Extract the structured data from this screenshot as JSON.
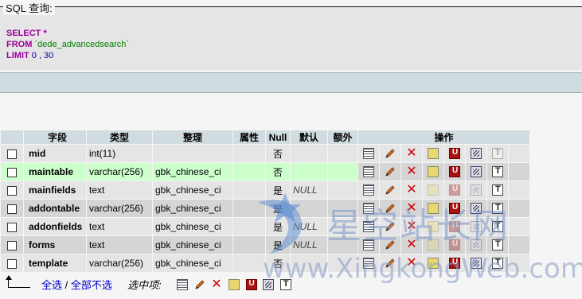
{
  "sql": {
    "legend": "SQL 查询:",
    "line1_kw": "SELECT",
    "line1_rest": " *",
    "line2_kw": "FROM",
    "line2_rest": " `dede_advancedsearch`",
    "line3_kw": "LIMIT",
    "line3_rest": " 0 , 30"
  },
  "columns": [
    "字段",
    "类型",
    "整理",
    "属性",
    "Null",
    "默认",
    "额外",
    "操作"
  ],
  "rows": [
    {
      "field": "mid",
      "type": "int(11)",
      "collation": "",
      "attributes": "",
      "null": "否",
      "default": "",
      "extra": ""
    },
    {
      "field": "maintable",
      "type": "varchar(256)",
      "collation": "gbk_chinese_ci",
      "attributes": "",
      "null": "否",
      "default": "",
      "extra": ""
    },
    {
      "field": "mainfields",
      "type": "text",
      "collation": "gbk_chinese_ci",
      "attributes": "",
      "null": "是",
      "default": "NULL",
      "extra": ""
    },
    {
      "field": "addontable",
      "type": "varchar(256)",
      "collation": "gbk_chinese_ci",
      "attributes": "",
      "null": "是",
      "default": "",
      "extra": ""
    },
    {
      "field": "addonfields",
      "type": "text",
      "collation": "gbk_chinese_ci",
      "attributes": "",
      "null": "是",
      "default": "NULL",
      "extra": ""
    },
    {
      "field": "forms",
      "type": "text",
      "collation": "gbk_chinese_ci",
      "attributes": "",
      "null": "是",
      "default": "NULL",
      "extra": ""
    },
    {
      "field": "template",
      "type": "varchar(256)",
      "collation": "gbk_chinese_ci",
      "attributes": "",
      "null": "否",
      "default": "",
      "extra": ""
    }
  ],
  "bottom": {
    "check_all": "全选",
    "separator": " / ",
    "uncheck_all": "全部不选",
    "with_selected": "选中项:"
  },
  "watermark": {
    "chinese": "星空站长网",
    "url": "www.XingkongWeb.com"
  },
  "colors": {
    "header_bg": "#d0dce0",
    "row_odd": "#e5e5e5",
    "row_even": "#d5d5d5",
    "highlight": "#ccffcc",
    "keyword": "#990099",
    "link": "#0000cc"
  }
}
